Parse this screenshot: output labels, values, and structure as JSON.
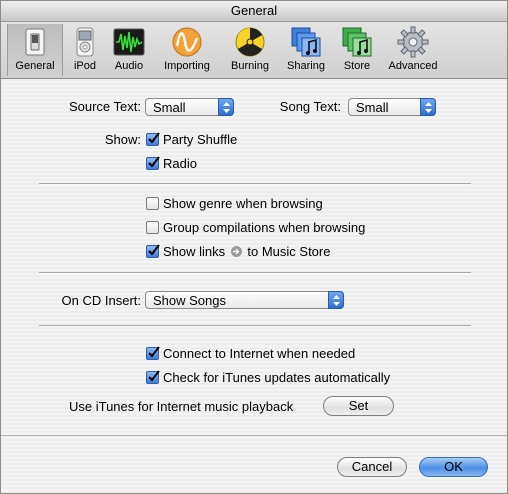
{
  "window": {
    "title": "General"
  },
  "toolbar": {
    "items": [
      {
        "label": "General",
        "icon": "switch-icon",
        "selected": true
      },
      {
        "label": "iPod",
        "icon": "ipod-icon"
      },
      {
        "label": "Audio",
        "icon": "audio-waveform-icon"
      },
      {
        "label": "Importing",
        "icon": "importing-icon"
      },
      {
        "label": "Burning",
        "icon": "burning-icon"
      },
      {
        "label": "Sharing",
        "icon": "sharing-icon"
      },
      {
        "label": "Store",
        "icon": "store-icon"
      },
      {
        "label": "Advanced",
        "icon": "gear-icon"
      }
    ]
  },
  "general": {
    "source_text_label": "Source Text:",
    "source_text_value": "Small",
    "song_text_label": "Song Text:",
    "song_text_value": "Small",
    "show_label": "Show:",
    "party_shuffle": {
      "label": "Party Shuffle",
      "checked": true
    },
    "radio": {
      "label": "Radio",
      "checked": true
    },
    "show_genre": {
      "label": "Show genre when browsing",
      "checked": false
    },
    "group_compilations": {
      "label": "Group compilations when browsing",
      "checked": false
    },
    "show_links": {
      "label_before": "Show links",
      "label_after": "to Music Store",
      "checked": true
    },
    "on_cd_insert_label": "On CD Insert:",
    "on_cd_insert_value": "Show Songs",
    "connect_internet": {
      "label": "Connect to Internet when needed",
      "checked": true
    },
    "check_updates": {
      "label": "Check for iTunes updates automatically",
      "checked": true
    },
    "internet_playback_label": "Use iTunes for Internet music playback",
    "set_button": "Set"
  },
  "footer": {
    "cancel": "Cancel",
    "ok": "OK"
  },
  "colors": {
    "accent": "#3d7fdc",
    "window_bg": "#ececec"
  }
}
